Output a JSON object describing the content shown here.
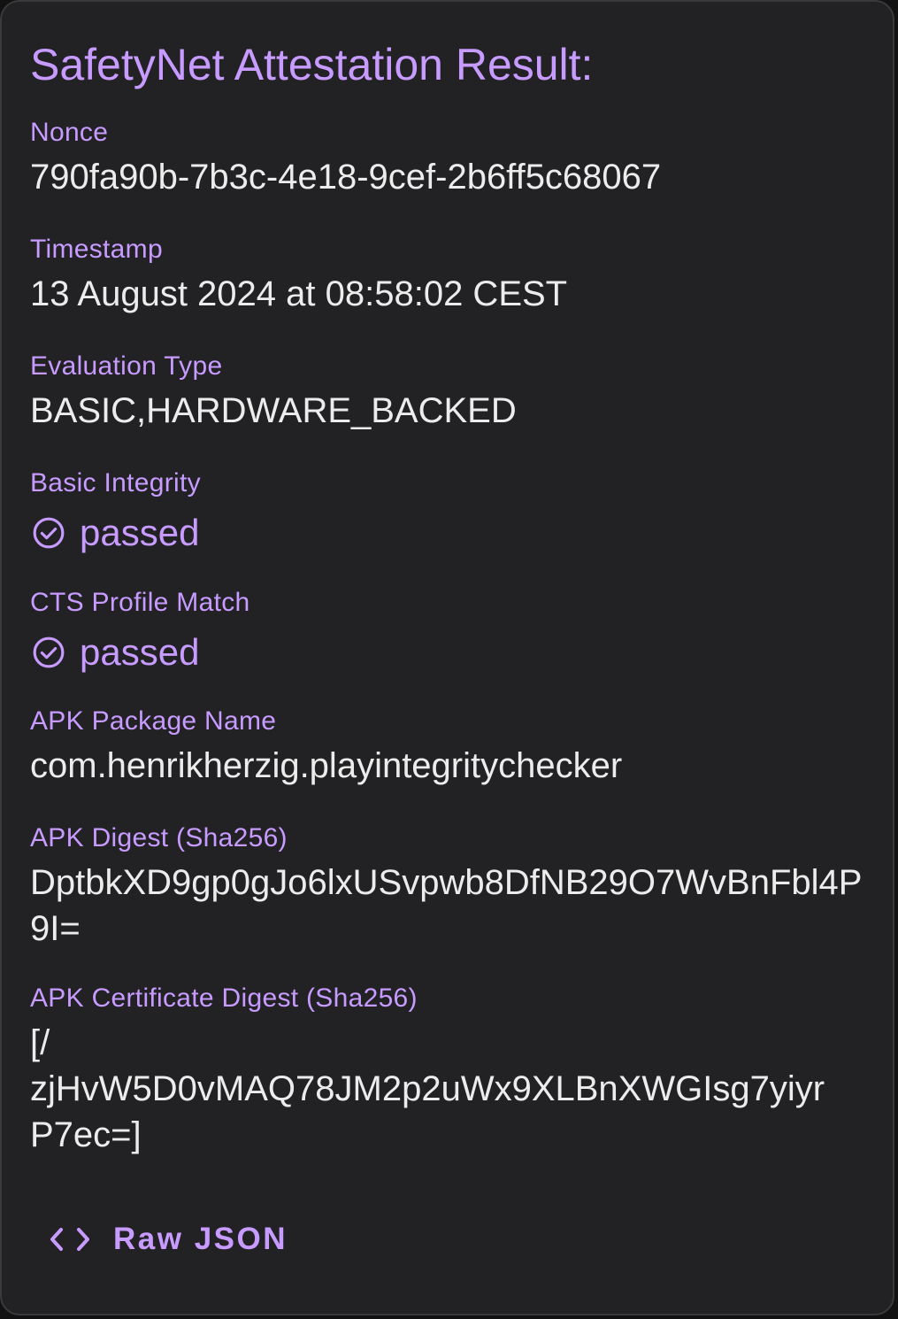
{
  "card": {
    "title": "SafetyNet Attestation Result:"
  },
  "fields": {
    "nonce": {
      "label": "Nonce",
      "value": "790fa90b-7b3c-4e18-9cef-2b6ff5c68067"
    },
    "timestamp": {
      "label": "Timestamp",
      "value": "13 August 2024 at 08:58:02 CEST"
    },
    "evaluation_type": {
      "label": "Evaluation Type",
      "value": "BASIC,HARDWARE_BACKED"
    },
    "basic_integrity": {
      "label": "Basic Integrity",
      "status": "passed",
      "icon": "check-circle-icon"
    },
    "cts_profile_match": {
      "label": "CTS Profile Match",
      "status": "passed",
      "icon": "check-circle-icon"
    },
    "apk_package_name": {
      "label": "APK Package Name",
      "value": "com.henrikherzig.playintegritychecker"
    },
    "apk_digest": {
      "label": "APK Digest (Sha256)",
      "value": "DptbkXD9gp0gJo6lxUSvpwb8DfNB29O7WvBnFbl4P9I="
    },
    "apk_certificate_digest": {
      "label": "APK Certificate Digest (Sha256)",
      "line1": "[/",
      "line2": "zjHvW5D0vMAQ78JM2p2uWx9XLBnXWGIsg7yiyr",
      "line3": "P7ec=]"
    }
  },
  "actions": {
    "raw_json_label": "Raw JSON",
    "raw_json_icon": "code-icon"
  },
  "colors": {
    "accent": "#c79bff",
    "background": "#222224",
    "text": "#ececec"
  }
}
